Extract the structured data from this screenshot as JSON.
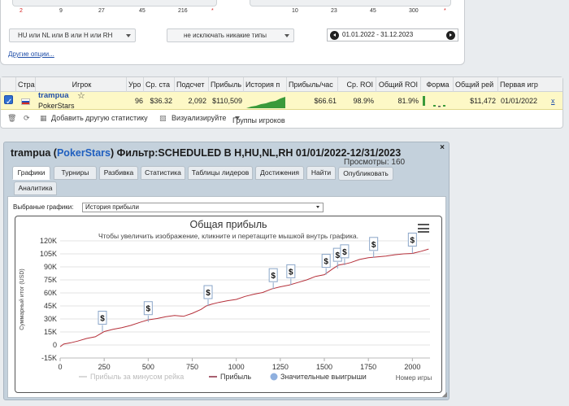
{
  "filters": {
    "slider1_ticks": [
      "2",
      "9",
      "27",
      "45",
      "216",
      "*"
    ],
    "slider2_ticks": [
      "10",
      "23",
      "45",
      "300",
      "*"
    ],
    "game_type": "HU или NL или B или H или RH",
    "exclude_types": "не исключать никакие типы",
    "date_range": "01.01.2022 - 31.12.2023",
    "more_options": "Другие опции..."
  },
  "table": {
    "headers": [
      "Стра",
      "Игрок",
      "Уро",
      "Ср. ста",
      "Подсчет",
      "Прибыль",
      "История п",
      "Прибыль/час",
      "Ср. ROI",
      "Общий ROI",
      "Форма",
      "Общий рей",
      "Первая игр"
    ],
    "row": {
      "player": "trampua",
      "site": "PokerStars",
      "level": "96",
      "avg_stake": "$36.32",
      "count": "2,092",
      "profit": "$110,509",
      "profit_hour": "$66.61",
      "avg_roi": "98.9%",
      "total_roi": "81.9%",
      "total_rake": "$11,472",
      "first_game": "01/01/2022",
      "remove": "x"
    },
    "toolbar": {
      "add_stats": "Добавить другую статистику",
      "visualize": "Визуализируйте",
      "groups": "Группы игроков"
    }
  },
  "report": {
    "player": "trampua",
    "site": "PokerStars",
    "filter_text": "Фильтр:SCHEDULED B H,HU,NL,RH 01/01/2022-12/31/2023",
    "views": "Просмотры: 160",
    "close": "×",
    "tabs": [
      "Графики",
      "Турниры",
      "Разбивка",
      "Статистика",
      "Таблицы лидеров",
      "Достижения",
      "Найти"
    ],
    "publish": "Опубликовать",
    "analytics": "Аналитика",
    "selected_label": "Выбраные графики:",
    "selected_value": "История прибыли"
  },
  "chart_data": {
    "type": "line",
    "title": "Общая прибыль",
    "subtitle": "Чтобы увеличить изображение, кликните и перетащите мышкой внутрь графика.",
    "xlabel": "Номер игры",
    "ylabel": "Суммарный итог (USD)",
    "xlim": [
      0,
      2100
    ],
    "ylim": [
      -15000,
      120000
    ],
    "xticks": [
      "0",
      "250",
      "500",
      "750",
      "1000",
      "1250",
      "1500",
      "1750",
      "2000"
    ],
    "yticks": [
      "-15K",
      "0",
      "15K",
      "30K",
      "45K",
      "60K",
      "75K",
      "90K",
      "105K",
      "120K"
    ],
    "legend": [
      "Прибыль за минусом рейка",
      "Прибыль",
      "Значительные выигрыши"
    ],
    "legend_position": "bottom",
    "series": [
      {
        "name": "Прибыль",
        "x": [
          0,
          20,
          60,
          100,
          150,
          200,
          250,
          300,
          350,
          400,
          460,
          500,
          550,
          600,
          650,
          700,
          750,
          800,
          830,
          860,
          900,
          950,
          1000,
          1050,
          1100,
          1150,
          1200,
          1250,
          1300,
          1350,
          1400,
          1450,
          1500,
          1550,
          1580,
          1620,
          1650,
          1700,
          1750,
          1800,
          1850,
          1900,
          1950,
          2000,
          2050,
          2092
        ],
        "y": [
          -2000,
          1000,
          2500,
          4500,
          7500,
          9500,
          15500,
          18000,
          20000,
          22500,
          26500,
          29000,
          30500,
          32500,
          34000,
          33000,
          36500,
          41000,
          45000,
          47000,
          49000,
          51000,
          52500,
          56000,
          58500,
          60500,
          64500,
          67000,
          69000,
          72000,
          75000,
          79000,
          81000,
          88000,
          92000,
          93500,
          95000,
          98500,
          100500,
          101500,
          102500,
          104000,
          105000,
          105500,
          108000,
          110509
        ]
      }
    ],
    "big_wins_marker": "$",
    "big_wins": [
      {
        "x": 240,
        "y": 15500
      },
      {
        "x": 500,
        "y": 26500
      },
      {
        "x": 840,
        "y": 45000
      },
      {
        "x": 1210,
        "y": 64500
      },
      {
        "x": 1310,
        "y": 69000
      },
      {
        "x": 1510,
        "y": 81000
      },
      {
        "x": 1575,
        "y": 88000
      },
      {
        "x": 1615,
        "y": 92000
      },
      {
        "x": 1780,
        "y": 100500
      },
      {
        "x": 2000,
        "y": 105500
      }
    ]
  }
}
